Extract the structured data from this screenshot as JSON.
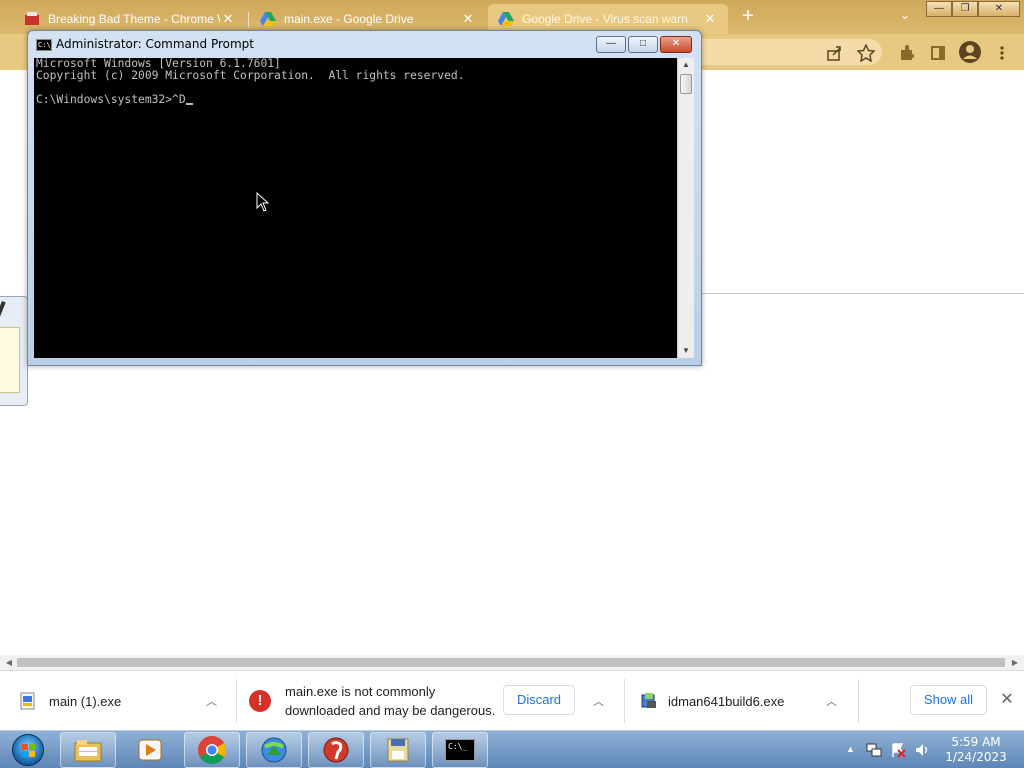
{
  "chrome": {
    "tabs": [
      {
        "title": "Breaking Bad Theme - Chrome W",
        "close": "✕",
        "icon": "breaking-bad-favicon"
      },
      {
        "title": "main.exe - Google Drive",
        "close": "✕",
        "icon": "google-drive-favicon"
      },
      {
        "title": "Google Drive - Virus scan warn",
        "close": "✕",
        "icon": "google-drive-favicon"
      }
    ],
    "new_tab": "+",
    "tab_search": "⌄",
    "window_controls": {
      "minimize": "—",
      "maximize": "❐",
      "close": "✕"
    },
    "toolbar_icons": [
      "share-icon",
      "bookmark-star-icon",
      "extensions-icon",
      "side-panel-icon",
      "profile-icon",
      "menu-icon"
    ]
  },
  "cmd": {
    "title": "Administrator: Command Prompt",
    "icon_text": "C:\\_",
    "buttons": {
      "minimize": "—",
      "maximize": "□",
      "close": "✕"
    },
    "lines": [
      "Microsoft Windows [Version 6.1.7601]",
      "Copyright (c) 2009 Microsoft Corporation.  All rights reserved.",
      "",
      "C:\\Windows\\system32>^D"
    ],
    "scroll_up": "▲",
    "scroll_down": "▼"
  },
  "page_scroll": {
    "left": "◀",
    "right": "▶"
  },
  "downloads": {
    "items": [
      {
        "name": "main (1).exe",
        "chevron": "︿"
      },
      {
        "warning_line1": "main.exe is not commonly",
        "warning_line2": "downloaded and may be dangerous.",
        "warning_mark": "!",
        "discard": "Discard",
        "chevron": "︿"
      },
      {
        "name": "idman641build6.exe",
        "chevron": "︿"
      }
    ],
    "show_all": "Show all",
    "close": "✕"
  },
  "taskbar": {
    "apps": [
      "windows-explorer-icon",
      "media-player-icon",
      "chrome-icon",
      "internet-download-manager-icon",
      "power-icon",
      "folder-icon",
      "command-prompt-icon"
    ],
    "cmd_icon_text": "C:\\_",
    "tray_arrow": "▲",
    "clock": {
      "time": "5:59 AM",
      "date": "1/24/2023"
    }
  },
  "colors": {
    "tab_strip": "#cfa85a",
    "toolbar": "#e9c881",
    "cmd_bg": "#000000",
    "cmd_text": "#c0c0c0",
    "warning_red": "#d93025",
    "link_blue": "#1a73e8",
    "taskbar": "#5e86b6"
  }
}
